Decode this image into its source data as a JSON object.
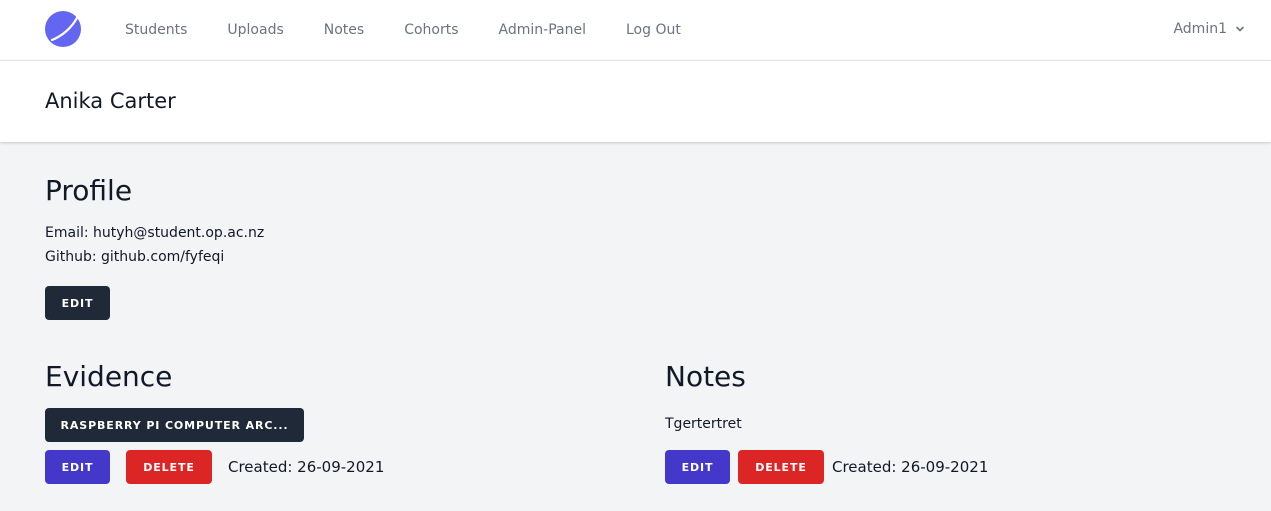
{
  "nav": {
    "links": [
      "Students",
      "Uploads",
      "Notes",
      "Cohorts",
      "Admin-Panel",
      "Log Out"
    ],
    "user": "Admin1",
    "logo_icon": "planet-logo-icon"
  },
  "header": {
    "title": "Anika Carter"
  },
  "profile": {
    "heading": "Profile",
    "email_line": "Email: hutyh@student.op.ac.nz",
    "github_line": "Github: github.com/fyfeqi",
    "edit_label": "EDIT"
  },
  "evidence": {
    "heading": "Evidence",
    "item_label": "RASPBERRY PI COMPUTER ARC...",
    "edit_label": "EDIT",
    "delete_label": "DELETE",
    "created": "Created: 26-09-2021"
  },
  "notes": {
    "heading": "Notes",
    "note_text": "Tgertertret",
    "edit_label": "EDIT",
    "delete_label": "DELETE",
    "created": "Created: 26-09-2021"
  },
  "colors": {
    "dark_button": "#1f2937",
    "edit_button": "#4338ca",
    "delete_button": "#dc2626",
    "logo": "#6366f1"
  }
}
